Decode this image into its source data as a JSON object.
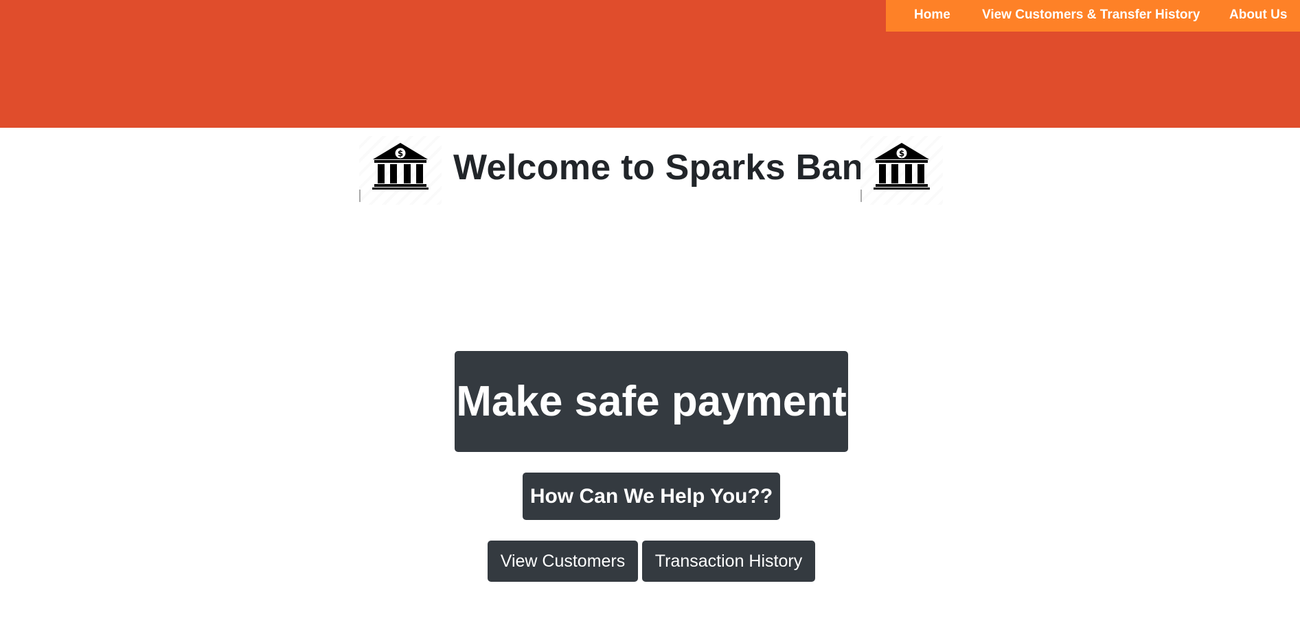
{
  "nav": {
    "home": "Home",
    "view_customers_history": "View Customers & Transfer History",
    "about": "About Us"
  },
  "welcome": {
    "title": "Welcome to Sparks Bank!!",
    "icon_left": "bank-icon",
    "icon_right": "bank-icon"
  },
  "buttons": {
    "make_payment": "Make safe payment",
    "help": "How Can We Help You??",
    "view_customers": "View Customers",
    "transaction_history": "Transaction History"
  },
  "colors": {
    "header_band": "#e04d2c",
    "nav_bar": "#fe8127",
    "button_dark": "#343a40",
    "text_dark": "#212529"
  }
}
